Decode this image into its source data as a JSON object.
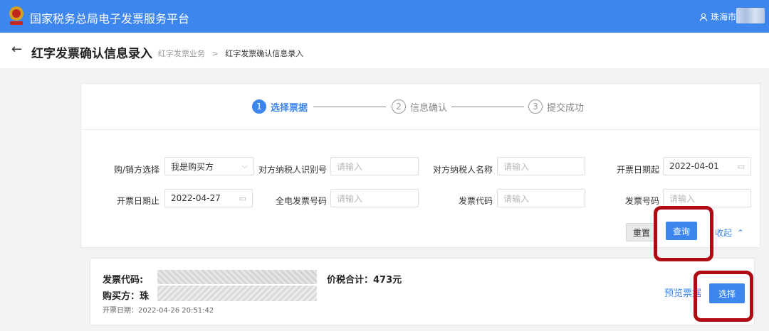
{
  "header": {
    "app_title": "国家税务总局电子发票服务平台",
    "user_label": "珠海市",
    "accent": "#3d86ee"
  },
  "subheader": {
    "title": "红字发票确认信息录入",
    "breadcrumbs": [
      "红字发票业务",
      "红字发票确认信息录入"
    ],
    "separator": ">"
  },
  "steps": [
    {
      "num": "1",
      "label": "选择票据",
      "active": true
    },
    {
      "num": "2",
      "label": "信息确认",
      "active": false
    },
    {
      "num": "3",
      "label": "提交成功",
      "active": false
    }
  ],
  "form": {
    "buyer_seller_label": "购/销方选择",
    "buyer_seller_value": "我是购买方",
    "counterparty_tax_id_label": "对方纳税人识别号",
    "counterparty_tax_id_placeholder": "请输入",
    "counterparty_name_label": "对方纳税人名称",
    "counterparty_name_placeholder": "请输入",
    "date_start_label": "开票日期起",
    "date_start_value": "2022-04-01",
    "date_end_label": "开票日期止",
    "date_end_value": "2022-04-27",
    "full_invoice_no_label": "全电发票号码",
    "full_invoice_no_placeholder": "请输入",
    "invoice_code_label": "发票代码",
    "invoice_code_placeholder": "请输入",
    "invoice_no_label": "发票号码",
    "invoice_no_placeholder": "请输入",
    "reset_label": "重置",
    "query_label": "查询",
    "collapse_label": "收起"
  },
  "result": {
    "invoice_code_label": "发票代码:",
    "buyer_label": "购买方：珠",
    "total_label": "价税合计：473元",
    "date_text": "开票日期：2022-04-26 20:51:42",
    "preview_label": "预览票据",
    "select_label": "选择"
  },
  "highlight_color": "#b00a14"
}
